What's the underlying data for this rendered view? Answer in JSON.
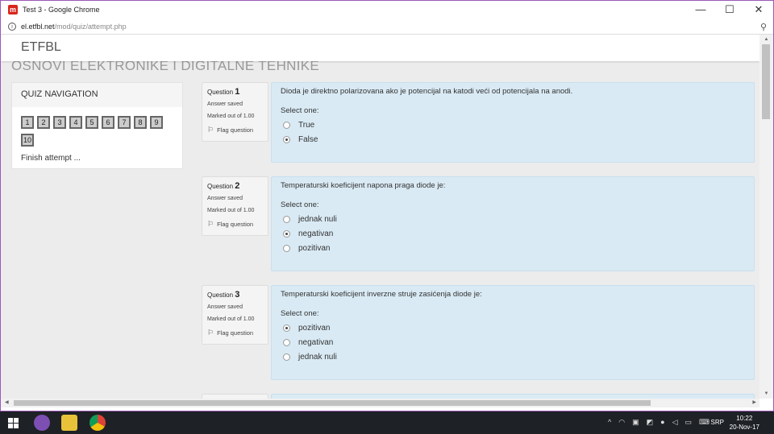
{
  "window": {
    "title": "Test 3 - Google Chrome",
    "app_icon": "m"
  },
  "window_buttons": {
    "minimize": "—",
    "maximize": "☐",
    "close": "✕"
  },
  "address": {
    "domain": "el.etfbl.net",
    "path": "/mod/quiz/attempt.php"
  },
  "site": {
    "brand": "ETFBL",
    "course_title": "OSNOVI ELEKTRONIKE I DIGITALNE TEHNIKE"
  },
  "quiz_nav": {
    "title": "QUIZ NAVIGATION",
    "buttons": [
      "1",
      "2",
      "3",
      "4",
      "5",
      "6",
      "7",
      "8",
      "9",
      "10"
    ],
    "finish": "Finish attempt ..."
  },
  "questions": [
    {
      "label": "Question",
      "number": "1",
      "status": "Answer saved",
      "marks": "Marked out of 1.00",
      "flag": "Flag question",
      "text": "Dioda je direktno polarizovana ako je potencijal na katodi veći od potencijala na anodi.",
      "select": "Select one:",
      "options": [
        "True",
        "False"
      ],
      "selected": 1
    },
    {
      "label": "Question",
      "number": "2",
      "status": "Answer saved",
      "marks": "Marked out of 1.00",
      "flag": "Flag question",
      "text": "Temperaturski koeficijent napona praga diode je:",
      "select": "Select one:",
      "options": [
        "jednak nuli",
        "negativan",
        "pozitivan"
      ],
      "selected": 1
    },
    {
      "label": "Question",
      "number": "3",
      "status": "Answer saved",
      "marks": "Marked out of 1.00",
      "flag": "Flag question",
      "text": "Temperaturski koeficijent inverzne struje zasićenja diode je:",
      "select": "Select one:",
      "options": [
        "pozitivan",
        "negativan",
        "jednak nuli"
      ],
      "selected": 0
    }
  ],
  "taskbar": {
    "lang": "SRP",
    "time": "10:22",
    "date": "20-Nov-17"
  },
  "colors": {
    "question_bg": "#d9eaf4",
    "taskbar": "#1e2126",
    "brand_red": "#d9261c"
  }
}
